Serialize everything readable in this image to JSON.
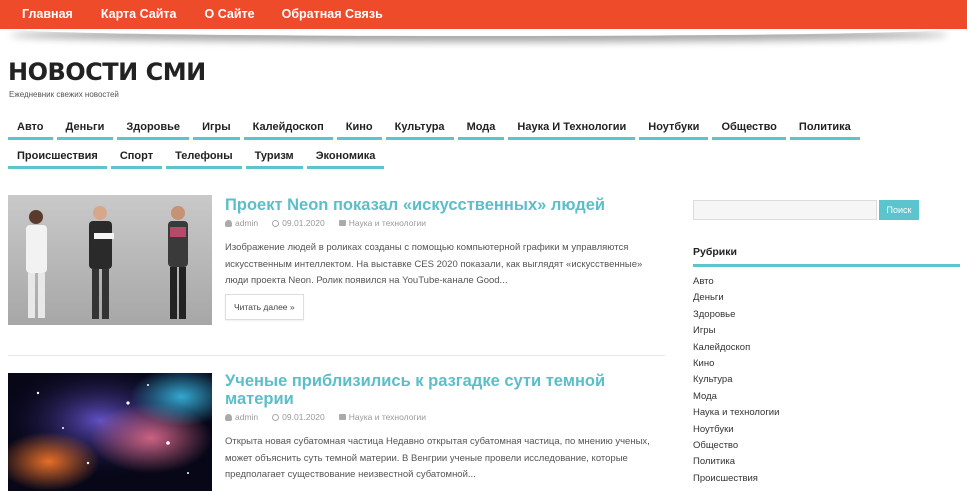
{
  "topnav": {
    "items": [
      "Главная",
      "Карта Сайта",
      "О Сайте",
      "Обратная Связь"
    ]
  },
  "site": {
    "title": "НОВОСТИ СМИ",
    "tagline": "Ежедневник свежих новостей"
  },
  "categories": {
    "row1": [
      "Авто",
      "Деньги",
      "Здоровье",
      "Игры",
      "Калейдоскоп",
      "Кино",
      "Культура",
      "Мода",
      "Наука И Технологии",
      "Ноутбуки",
      "Общество",
      "Политика"
    ],
    "row2": [
      "Происшествия",
      "Спорт",
      "Телефоны",
      "Туризм",
      "Экономика"
    ]
  },
  "posts": [
    {
      "title": "Проект Neon показал «искусственных» людей",
      "author": "admin",
      "date": "09.01.2020",
      "category": "Наука и технологии",
      "excerpt": "Изображение людей в роликах созданы с помощью компьютерной графики м управляются искусственным интеллектом. На выставке CES 2020 показали, как выглядят «искусственные» люди проекта Neon. Ролик появился на YouTube-канале Good...",
      "readmore": "Читать далее »"
    },
    {
      "title": "Ученые приблизились к разгадке сути темной материи",
      "author": "admin",
      "date": "09.01.2020",
      "category": "Наука и технологии",
      "excerpt": "Открыта новая субатомная частица Недавно открытая субатомная частица, по мнению ученых, может объяснить суть темной материи. В Венгрии ученые провели исследование, которые предполагает существование неизвестной субатомной..."
    }
  ],
  "sidebar": {
    "search_placeholder": "",
    "search_button": "Поиск",
    "widget_title": "Рубрики",
    "rubrics": [
      "Авто",
      "Деньги",
      "Здоровье",
      "Игры",
      "Калейдоскоп",
      "Кино",
      "Культура",
      "Мода",
      "Наука и технологии",
      "Ноутбуки",
      "Общество",
      "Политика",
      "Происшествия"
    ]
  },
  "colors": {
    "topbar": "#ee4b2b",
    "accent": "#5bc4cc",
    "title_link": "#5bbec8"
  }
}
